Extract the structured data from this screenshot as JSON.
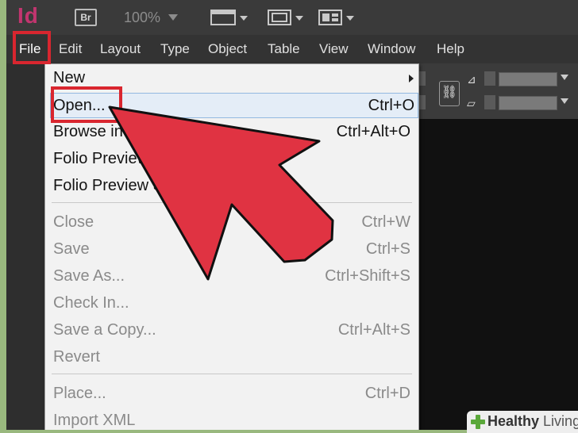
{
  "app": {
    "logo": "Id",
    "bridge": "Br",
    "zoom": "100%"
  },
  "menubar": {
    "items": [
      "File",
      "Edit",
      "Layout",
      "Type",
      "Object",
      "Table",
      "View",
      "Window",
      "Help"
    ]
  },
  "file_menu": {
    "items": [
      {
        "label": "New",
        "shortcut": "",
        "submenu": true,
        "disabled": false
      },
      {
        "label": "Open...",
        "shortcut": "Ctrl+O",
        "disabled": false,
        "selected": true
      },
      {
        "label": "Browse in",
        "shortcut": "Ctrl+Alt+O",
        "disabled": false
      },
      {
        "label": "Folio Preview",
        "shortcut": "",
        "disabled": false
      },
      {
        "label": "Folio Preview S",
        "shortcut": "",
        "disabled": false
      },
      {
        "label": "Close",
        "shortcut": "Ctrl+W",
        "disabled": true
      },
      {
        "label": "Save",
        "shortcut": "Ctrl+S",
        "disabled": true
      },
      {
        "label": "Save As...",
        "shortcut": "Ctrl+Shift+S",
        "disabled": true
      },
      {
        "label": "Check In...",
        "shortcut": "",
        "disabled": true
      },
      {
        "label": "Save a Copy...",
        "shortcut": "Ctrl+Alt+S",
        "disabled": true
      },
      {
        "label": "Revert",
        "shortcut": "",
        "disabled": true
      },
      {
        "label": "Place...",
        "shortcut": "Ctrl+D",
        "disabled": true
      },
      {
        "label": "Import XML",
        "shortcut": "",
        "disabled": true
      }
    ]
  },
  "colors": {
    "highlight": "#d9262f",
    "arrow": "#e03342",
    "accent_logo": "#c2356f"
  },
  "watermark": {
    "brand": "Healthy",
    "suffix": "Living"
  }
}
